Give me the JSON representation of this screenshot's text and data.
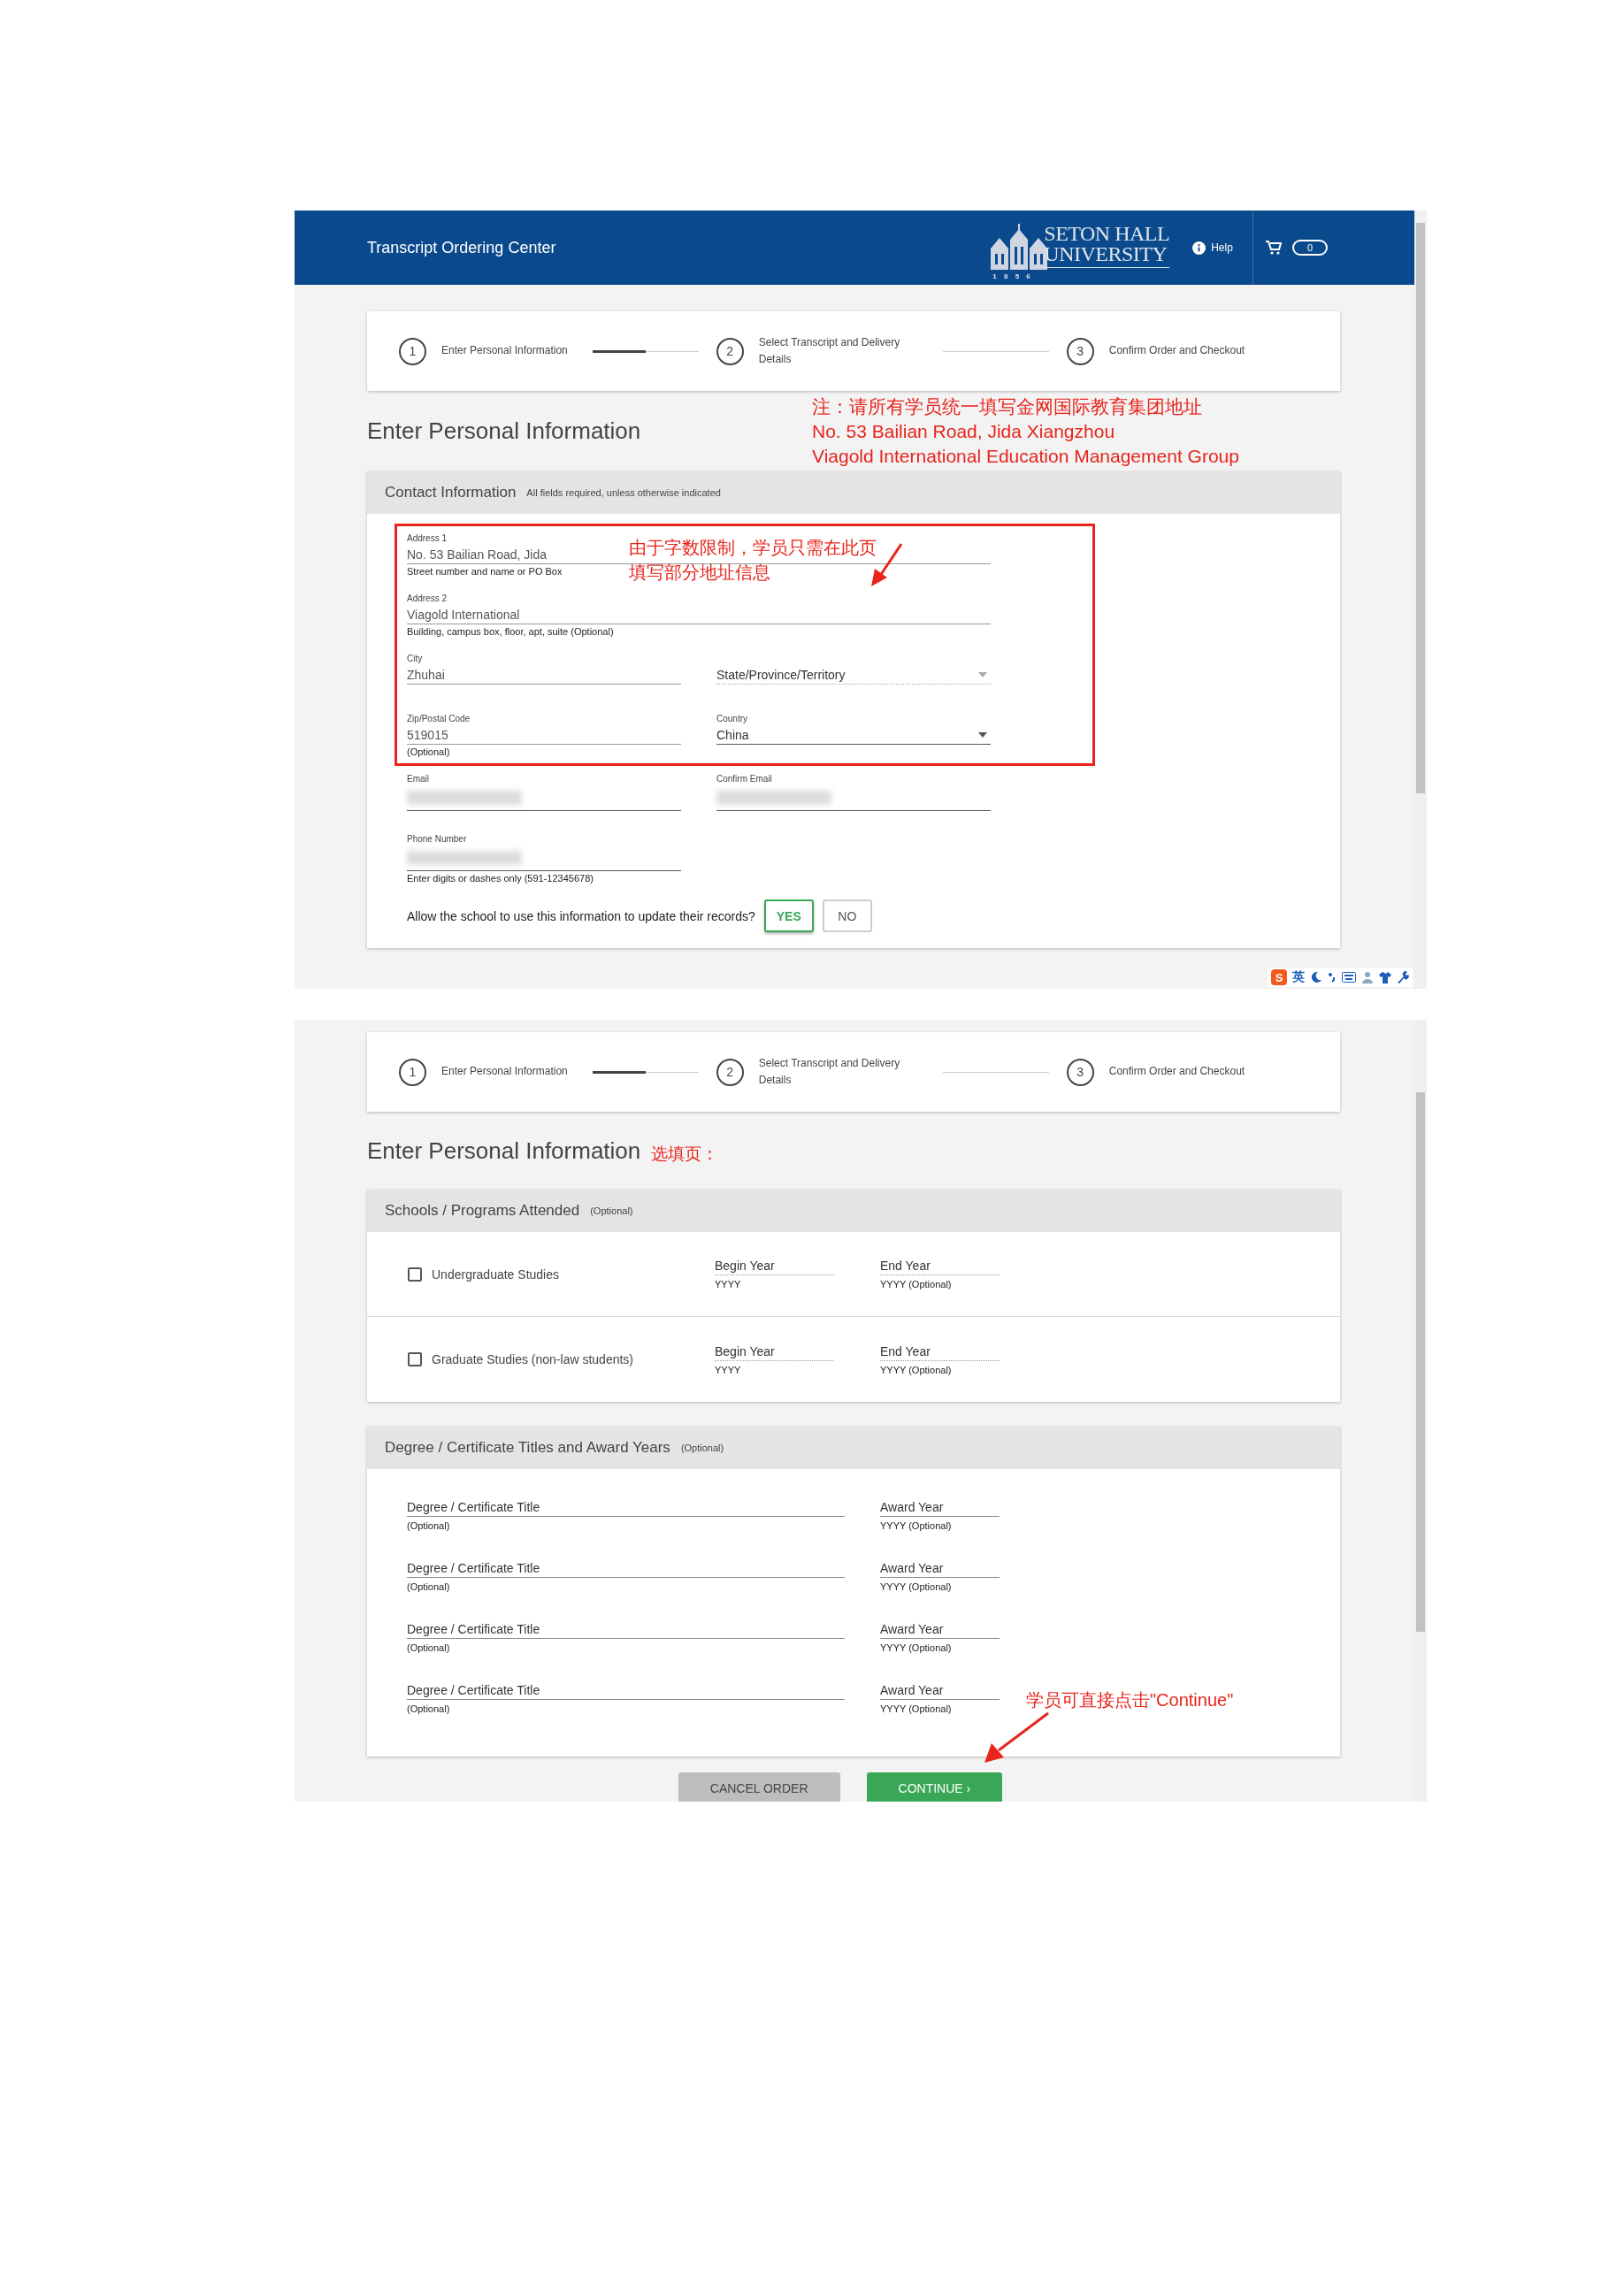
{
  "header": {
    "title": "Transcript Ordering Center",
    "logo_line_1": "SETON HALL",
    "logo_line_2": "UNIVERSITY",
    "logo_year": "1 8 5 6",
    "help": "Help",
    "cart_count": "0"
  },
  "panel_1": {
    "stepper": {
      "steps": [
        {
          "number": "1",
          "label": "Enter Personal Information"
        },
        {
          "number": "2",
          "label": "Select Transcript and Delivery Details"
        },
        {
          "number": "3",
          "label": "Confirm Order and Checkout"
        }
      ],
      "connectors": [
        {
          "level": 0.5
        },
        {
          "level": 0
        }
      ]
    },
    "page_title": "Enter Personal Information",
    "note_lines": [
      "注：请所有学员统一填写金网国际教育集团地址",
      "No. 53 Bailian Road, Jida Xiangzhou",
      "Viagold International Education Management Group"
    ],
    "contact": {
      "title": "Contact Information",
      "hint": "All fields required, unless otherwise indicated",
      "annotation_lines": [
        "由于字数限制，学员只需在此页",
        "填写部分地址信息"
      ],
      "fields": [
        {
          "kind": "text",
          "wide": true,
          "label": "Address 1",
          "value": "No. 53 Bailian Road, Jida",
          "helper": "Street number and name or PO Box"
        },
        {
          "kind": "text",
          "wide": true,
          "label": "Address 2",
          "value": "Viagold International",
          "helper": "Building, campus box, floor, apt, suite (Optional)"
        },
        {
          "kind": "text",
          "wide": false,
          "label": "City",
          "value": "Zhuhai"
        },
        {
          "kind": "select",
          "wide": false,
          "placeholder": "State/Province/Territory"
        },
        {
          "kind": "text",
          "wide": false,
          "label": "Zip/Postal Code",
          "value": "519015",
          "helper": "(Optional)"
        },
        {
          "kind": "select",
          "wide": false,
          "label": "Country",
          "value": "China"
        },
        {
          "kind": "redacted",
          "wide": false,
          "label": "Email"
        },
        {
          "kind": "redacted",
          "wide": false,
          "label": "Confirm Email"
        },
        {
          "kind": "redacted",
          "wide": false,
          "label": "Phone Number",
          "helper": "Enter digits or dashes only (591-12345678)"
        }
      ],
      "question": "Allow the school to use this information to update their records?",
      "choices": [
        {
          "label": "YES",
          "selected": true
        },
        {
          "label": "NO",
          "selected": false
        }
      ]
    },
    "ime": {
      "logo": "S",
      "label": "英"
    }
  },
  "panel_2": {
    "stepper": {
      "steps": [
        {
          "number": "1",
          "label": "Enter Personal Information"
        },
        {
          "number": "2",
          "label": "Select Transcript and Delivery Details"
        },
        {
          "number": "3",
          "label": "Confirm Order and Checkout"
        }
      ],
      "connectors": [
        {
          "level": 0.5
        },
        {
          "level": 0
        }
      ]
    },
    "page_title": "Enter Personal Information",
    "note": "选填页：",
    "schools": {
      "title": "Schools / Programs Attended",
      "tag": "(Optional)",
      "rows": [
        {
          "label": "Undergraduate Studies",
          "checked": false,
          "begin_label": "Begin Year",
          "begin_hint": "YYYY",
          "end_label": "End Year",
          "end_hint": "YYYY (Optional)"
        },
        {
          "label": "Graduate Studies (non-law students)",
          "checked": false,
          "begin_label": "Begin Year",
          "begin_hint": "YYYY",
          "end_label": "End Year",
          "end_hint": "YYYY (Optional)"
        }
      ]
    },
    "degrees": {
      "title": "Degree / Certificate Titles and Award Years",
      "tag": "(Optional)",
      "rows": [
        {
          "title_label": "Degree / Certificate Title",
          "title_hint": "(Optional)",
          "year_label": "Award Year",
          "year_hint": "YYYY (Optional)"
        },
        {
          "title_label": "Degree / Certificate Title",
          "title_hint": "(Optional)",
          "year_label": "Award Year",
          "year_hint": "YYYY (Optional)"
        },
        {
          "title_label": "Degree / Certificate Title",
          "title_hint": "(Optional)",
          "year_label": "Award Year",
          "year_hint": "YYYY (Optional)"
        },
        {
          "title_label": "Degree / Certificate Title",
          "title_hint": "(Optional)",
          "year_label": "Award Year",
          "year_hint": "YYYY (Optional)"
        }
      ]
    },
    "continue_note": "学员可直接点击\"Continue\"",
    "buttons": [
      {
        "kind": "secondary",
        "label": "CANCEL ORDER"
      },
      {
        "kind": "primary",
        "label": "CONTINUE ›"
      }
    ]
  }
}
